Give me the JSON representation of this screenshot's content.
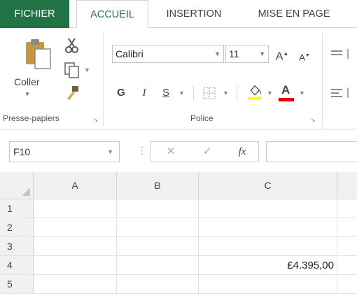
{
  "tabs": [
    {
      "label": "FICHIER"
    },
    {
      "label": "ACCUEIL"
    },
    {
      "label": "INSERTION"
    },
    {
      "label": "MISE EN PAGE"
    }
  ],
  "clipboard_group": {
    "paste_label": "Coller",
    "group_label": "Presse-papiers"
  },
  "font_group": {
    "font_name": "Calibri",
    "font_size": "11",
    "grow_font": "A",
    "shrink_font": "A",
    "bold": "G",
    "italic": "I",
    "underline": "S",
    "font_color_letter": "A",
    "group_label": "Police"
  },
  "formula_bar": {
    "name_box": "F10",
    "cancel": "✕",
    "enter": "✓",
    "function": "fx",
    "formula_value": ""
  },
  "sheet": {
    "columns": [
      "A",
      "B",
      "C"
    ],
    "rows": [
      {
        "num": "1",
        "A": "",
        "B": "",
        "C": ""
      },
      {
        "num": "2",
        "A": "",
        "B": "",
        "C": ""
      },
      {
        "num": "3",
        "A": "",
        "B": "",
        "C": ""
      },
      {
        "num": "4",
        "A": "",
        "B": "",
        "C": "£4.395,00"
      },
      {
        "num": "5",
        "A": "",
        "B": "",
        "C": ""
      }
    ]
  },
  "colors": {
    "accent_green": "#217346",
    "fill_yellow": "#ffff00",
    "font_red": "#e00000"
  },
  "icons": [
    "paste-icon",
    "cut-icon",
    "copy-icon",
    "format-painter-icon",
    "border-icon",
    "fill-color-icon",
    "font-color-icon",
    "align-top-icon",
    "align-left-icon",
    "dialog-launcher-icon"
  ]
}
